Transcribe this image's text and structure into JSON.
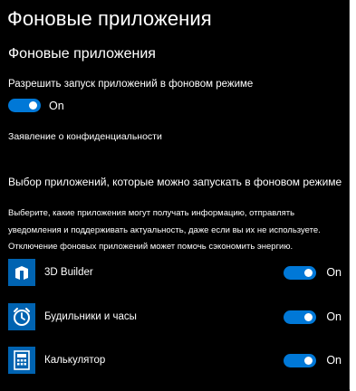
{
  "page": {
    "title": "Фоновые приложения",
    "section_title": "Фоновые приложения",
    "allow_label": "Разрешить запуск приложений в фоновом режиме",
    "allow_toggle_state": "On",
    "privacy_link": "Заявление о конфиденциальности",
    "choose_title": "Выбор приложений, которые можно запускать в фоновом режиме",
    "description": "Выберите, какие приложения могут получать информацию, отправлять уведомления и поддерживать актуальность, даже если вы их не используете. Отключение фоновых приложений может помочь сэкономить энергию."
  },
  "apps": [
    {
      "name": "3D Builder",
      "state": "On",
      "icon": "3d-builder-icon"
    },
    {
      "name": "Будильники и часы",
      "state": "On",
      "icon": "alarm-clock-icon"
    },
    {
      "name": "Калькулятор",
      "state": "On",
      "icon": "calculator-icon"
    }
  ],
  "colors": {
    "background": "#000000",
    "accent": "#0078d7",
    "app_tile": "#0063b1",
    "text": "#ffffff"
  }
}
